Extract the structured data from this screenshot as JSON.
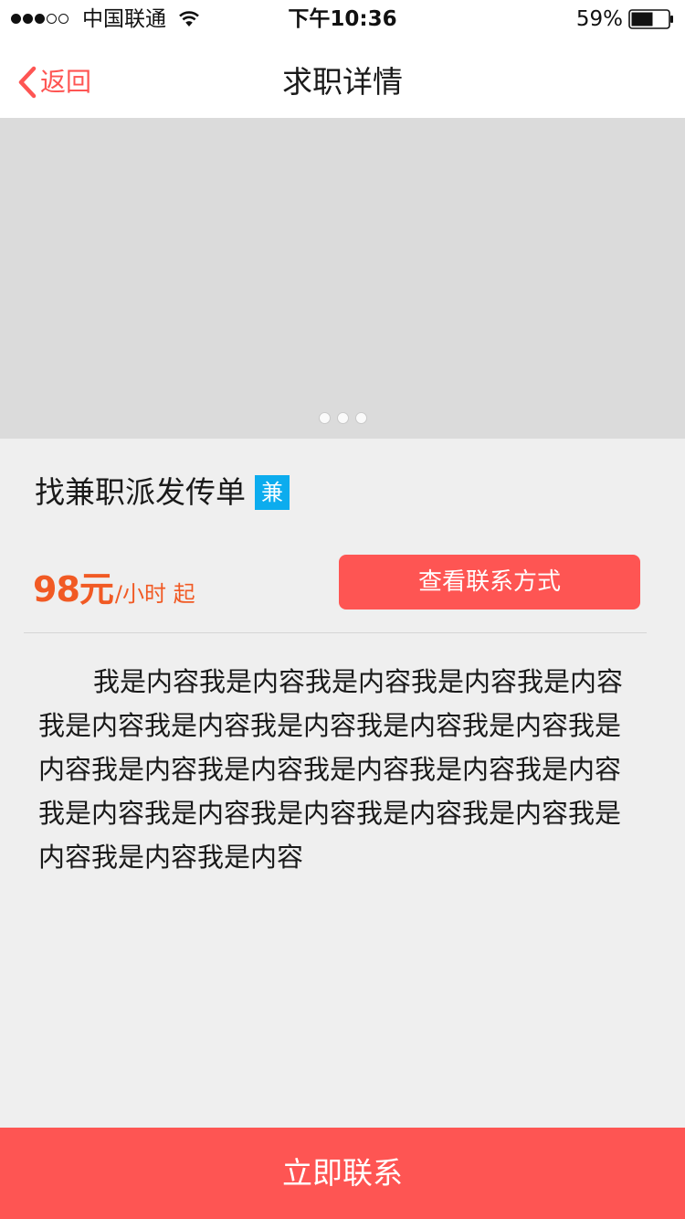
{
  "status_bar": {
    "carrier": "中国联通",
    "time": "下午10:36",
    "battery_percent": "59%",
    "battery_level": 0.59,
    "signal_strength": 3,
    "signal_max": 5,
    "icons": [
      "signal-dots-icon",
      "wifi-icon",
      "battery-icon"
    ]
  },
  "nav": {
    "back_label": "返回",
    "title": "求职详情"
  },
  "banner": {
    "page_count": 3,
    "current_page": 1
  },
  "job": {
    "title": "找兼职派发传单",
    "badge": "兼",
    "salary_amount": "98元",
    "salary_unit": "/小时 起",
    "contact_info_label": "查看联系方式",
    "description": "我是内容我是内容我是内容我是内容我是内容我是内容我是内容我是内容我是内容我是内容我是内容我是内容我是内容我是内容我是内容我是内容我是内容我是内容我是内容我是内容我是内容我是内容我是内容我是内容"
  },
  "bottom": {
    "contact_now_label": "立即联系"
  },
  "colors": {
    "accent": "#fe5553",
    "salary": "#f15a24",
    "badge": "#0cacee",
    "banner_placeholder": "#dbdbdb",
    "page_background": "#efefef"
  }
}
